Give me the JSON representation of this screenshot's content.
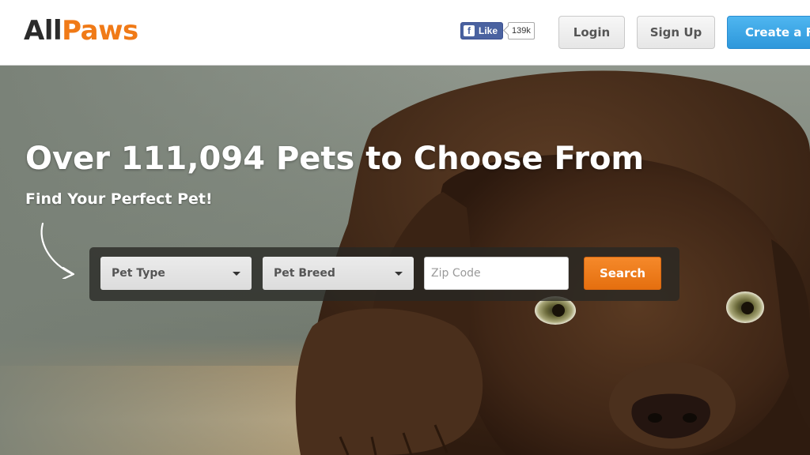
{
  "header": {
    "logo": {
      "part1": "All",
      "part2": "Paws"
    },
    "facebook": {
      "like_label": "Like",
      "like_count": "139k",
      "icon": "facebook-icon"
    },
    "login_label": "Login",
    "signup_label": "Sign Up",
    "create_label": "Create a Fr"
  },
  "hero": {
    "title": "Over 111,094 Pets to Choose From",
    "subtitle": "Find Your Perfect Pet!",
    "search": {
      "pet_type": "Pet Type",
      "pet_breed": "Pet Breed",
      "zip_placeholder": "Zip Code",
      "button_label": "Search"
    }
  },
  "colors": {
    "brand_orange": "#f07a17",
    "create_blue": "#2d97db",
    "search_orange": "#e56f0f",
    "facebook_blue": "#4a62a0"
  }
}
